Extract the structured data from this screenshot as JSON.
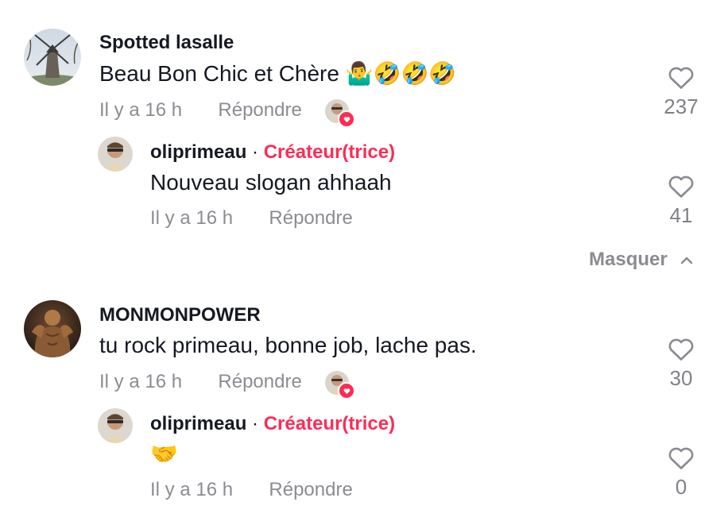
{
  "comments": [
    {
      "username": "Spotted lasalle",
      "text": "Beau Bon Chic et Chère 🤷‍♂️🤣🤣🤣",
      "time": "Il y a 16 h",
      "reply_label": "Répondre",
      "likes": "237",
      "liked_by_creator": true,
      "replies": [
        {
          "username": "oliprimeau",
          "separator": "·",
          "badge": "Créateur(trice)",
          "text": "Nouveau slogan ahhaah",
          "time": "Il y a 16 h",
          "reply_label": "Répondre",
          "likes": "41"
        }
      ],
      "hide_replies_label": "Masquer"
    },
    {
      "username": "MONMONPOWER",
      "text": "tu rock primeau, bonne job, lache pas.",
      "time": "Il y a 16 h",
      "reply_label": "Répondre",
      "likes": "30",
      "liked_by_creator": true,
      "replies": [
        {
          "username": "oliprimeau",
          "separator": "·",
          "badge": "Créateur(trice)",
          "text": "🤝",
          "time": "Il y a 16 h",
          "reply_label": "Répondre",
          "likes": "0"
        }
      ]
    }
  ],
  "colors": {
    "text": "#161823",
    "muted": "#8a8b91",
    "accent": "#fe2c55"
  },
  "icons": {
    "like": "heart-outline-icon",
    "liked_badge": "heart-filled-icon",
    "collapse": "chevron-up-icon"
  }
}
